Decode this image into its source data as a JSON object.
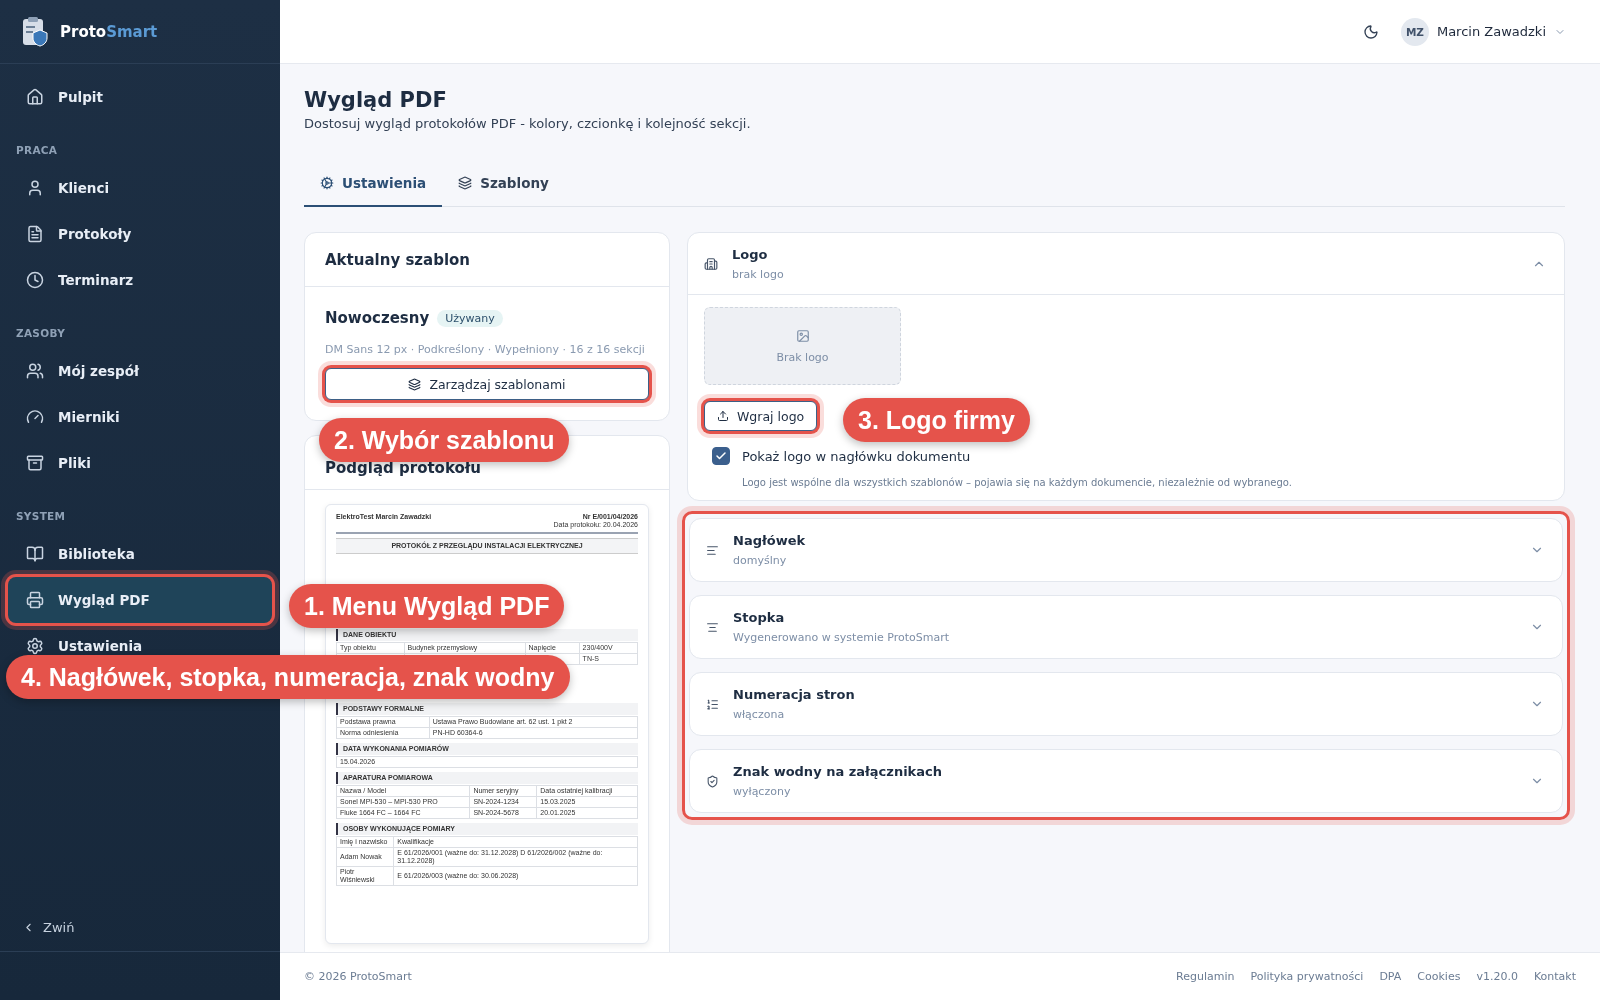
{
  "sidebar": {
    "brand_first": "Proto",
    "brand_second": "Smart",
    "groups": [
      {
        "items": [
          {
            "label": "Pulpit",
            "selected": false,
            "highlighted": false
          }
        ]
      },
      {
        "heading": "PRACA",
        "items": [
          {
            "label": "Klienci",
            "selected": false,
            "highlighted": false
          },
          {
            "label": "Protokoły",
            "selected": false,
            "highlighted": false
          },
          {
            "label": "Terminarz",
            "selected": false,
            "highlighted": false
          }
        ]
      },
      {
        "heading": "ZASOBY",
        "items": [
          {
            "label": "Mój zespół",
            "selected": false,
            "highlighted": false
          },
          {
            "label": "Mierniki",
            "selected": false,
            "highlighted": false
          },
          {
            "label": "Pliki",
            "selected": false,
            "highlighted": false
          }
        ]
      },
      {
        "heading": "SYSTEM",
        "items": [
          {
            "label": "Biblioteka",
            "selected": false,
            "highlighted": false
          },
          {
            "label": "Wygląd PDF",
            "selected": true,
            "highlighted": true
          },
          {
            "label": "Ustawienia",
            "selected": false,
            "highlighted": false
          }
        ]
      }
    ],
    "collapse": "Zwiń"
  },
  "topbar": {
    "user_initials": "MZ",
    "user_name": "Marcin Zawadzki"
  },
  "page": {
    "title": "Wygląd PDF",
    "subtitle": "Dostosuj wygląd protokołów PDF - kolory, czcionkę i kolejność sekcji.",
    "tabs": [
      {
        "label": "Ustawienia",
        "selected": true
      },
      {
        "label": "Szablony",
        "selected": false
      }
    ]
  },
  "template_card": {
    "title": "Aktualny szablon",
    "name": "Nowoczesny",
    "badge": "Używany",
    "details": "DM Sans 12 px · Podkreślony · Wypełniony · 16 z 16 sekcji",
    "button": "Zarządzaj szablonami",
    "highlighted": true
  },
  "preview_card": {
    "title": "Podgląd protokołu",
    "document": {
      "company": "ElektroTest Marcin Zawadzki",
      "number": "Nr E/001/04/2026",
      "date": "Data protokołu: 20.04.2026",
      "title": "PROTOKÓŁ Z PRZEGLĄDU INSTALACJI ELEKTRYCZNEJ",
      "sections": [
        {
          "heading": "DANE OBIEKTU",
          "rows": [
            [
              "Typ obiektu",
              "Budynek przemysłowy",
              "Napięcie",
              "230/400V"
            ],
            [
              null,
              null,
              null,
              "TN-S"
            ]
          ]
        },
        {
          "heading": "PODSTAWY FORMALNE",
          "rows": [
            [
              "Podstawa prawna",
              "Ustawa Prawo Budowlane art. 62 ust. 1 pkt 2"
            ],
            [
              "Norma odniesienia",
              "PN-HD 60364-6"
            ]
          ]
        },
        {
          "heading": "DATA WYKONANIA POMIARÓW",
          "rows": [
            [
              "15.04.2026"
            ]
          ]
        },
        {
          "heading": "APARATURA POMIAROWA",
          "rows": [
            [
              "Nazwa / Model",
              "Numer seryjny",
              "Data ostatniej kalibracji"
            ],
            [
              "Sonel MPI-530 – MPI-530 PRO",
              "SN-2024-1234",
              "15.03.2025"
            ],
            [
              "Fluke 1664 FC – 1664 FC",
              "SN-2024-5678",
              "20.01.2025"
            ]
          ]
        },
        {
          "heading": "OSOBY WYKONUJĄCE POMIARY",
          "rows": [
            [
              "Imię i nazwisko",
              "Kwalifikacje"
            ],
            [
              "Adam Nowak",
              "E 61/2026/001 (ważne do: 31.12.2028) D 61/2026/002 (ważne do: 31.12.2028)"
            ],
            [
              "Piotr Wiśniewski",
              "E 61/2026/003 (ważne do: 30.06.2028)"
            ]
          ]
        }
      ]
    }
  },
  "logo_section": {
    "title": "Logo",
    "subtitle": "brak logo",
    "expanded": true,
    "placeholder": "Brak logo",
    "upload_button": "Wgraj logo",
    "upload_highlighted": true,
    "checkbox": {
      "label": "Pokaż logo w nagłówku dokumentu",
      "checked": true
    },
    "note": "Logo jest wspólne dla wszystkich szablonów – pojawia się na każdym dokumencie, niezależnie od wybranego."
  },
  "sections_highlighted": true,
  "sections": [
    {
      "title": "Nagłówek",
      "subtitle": "domyślny",
      "expanded": false
    },
    {
      "title": "Stopka",
      "subtitle": "Wygenerowano w systemie ProtoSmart",
      "expanded": false
    },
    {
      "title": "Numeracja stron",
      "subtitle": "włączona",
      "expanded": false
    },
    {
      "title": "Znak wodny na załącznikach",
      "subtitle": "wyłączony",
      "expanded": false
    }
  ],
  "annotations": [
    {
      "label": "2. Wybór szablonu"
    },
    {
      "label": "3. Logo firmy"
    },
    {
      "label": "1. Menu Wygląd PDF"
    },
    {
      "label": "4. Nagłówek, stopka, numeracja, znak wodny"
    }
  ],
  "footer": {
    "copyright": "© 2026 ProtoSmart",
    "links": [
      "Regulamin",
      "Polityka prywatności",
      "DPA",
      "Cookies",
      "v1.20.0",
      "Kontakt"
    ]
  }
}
